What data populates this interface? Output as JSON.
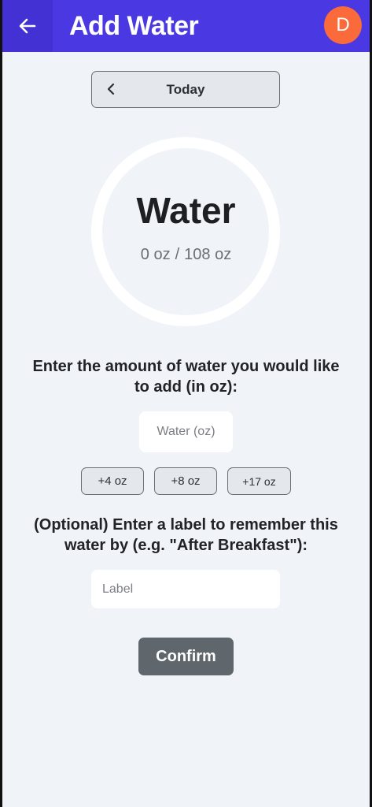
{
  "header": {
    "title": "Add Water",
    "back_icon": "arrow-left-icon",
    "avatar_initial": "D",
    "bg_color": "#4a39e3",
    "avatar_color": "#fb6a3a"
  },
  "date_selector": {
    "label": "Today",
    "prev_icon": "chevron-left-icon"
  },
  "summary": {
    "title": "Water",
    "current": "0 oz",
    "separator": "/",
    "goal": "108 oz",
    "progress_fraction": 0
  },
  "amount": {
    "prompt": "Enter the amount of water you would like to add (in oz):",
    "placeholder": "Water (oz)",
    "value": ""
  },
  "quick_add": [
    {
      "label": "+4 oz"
    },
    {
      "label": "+8 oz"
    },
    {
      "label": "+17 oz"
    }
  ],
  "label_field": {
    "prompt": "(Optional) Enter a label to remember this water by (e.g. \"After Breakfast\"):",
    "placeholder": "Label",
    "value": ""
  },
  "confirm": {
    "label": "Confirm",
    "color": "#5f666c"
  }
}
